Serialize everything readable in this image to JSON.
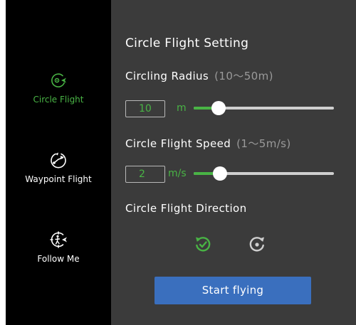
{
  "sidebar": {
    "items": [
      {
        "label": "Circle Flight",
        "icon": "circle-flight-icon",
        "active": true
      },
      {
        "label": "Waypoint Flight",
        "icon": "waypoint-flight-icon",
        "active": false
      },
      {
        "label": "Follow Me",
        "icon": "follow-me-icon",
        "active": false
      }
    ]
  },
  "settings": {
    "title": "Circle Flight Setting",
    "radius": {
      "label": "Circling Radius",
      "range": "(10～50m)",
      "value": "10",
      "unit": "m",
      "min": 10,
      "max": 50,
      "level": 0.18
    },
    "speed": {
      "label": "Circle Flight Speed",
      "range": "(1～5m/s)",
      "value": "2",
      "unit": "m/s",
      "min": 1,
      "max": 5,
      "level": 0.19
    },
    "direction": {
      "label": "Circle Flight Direction",
      "options": [
        {
          "icon": "rotate-ccw-check-icon",
          "selected": true
        },
        {
          "icon": "rotate-cw-icon",
          "selected": false
        }
      ]
    },
    "start_label": "Start flying"
  },
  "colors": {
    "accent": "#49b445",
    "panel": "#3b3b3b",
    "sidebar": "#000000",
    "button": "#3a6fbe",
    "track": "#cfcfcf",
    "muted": "#9a9a9a"
  }
}
